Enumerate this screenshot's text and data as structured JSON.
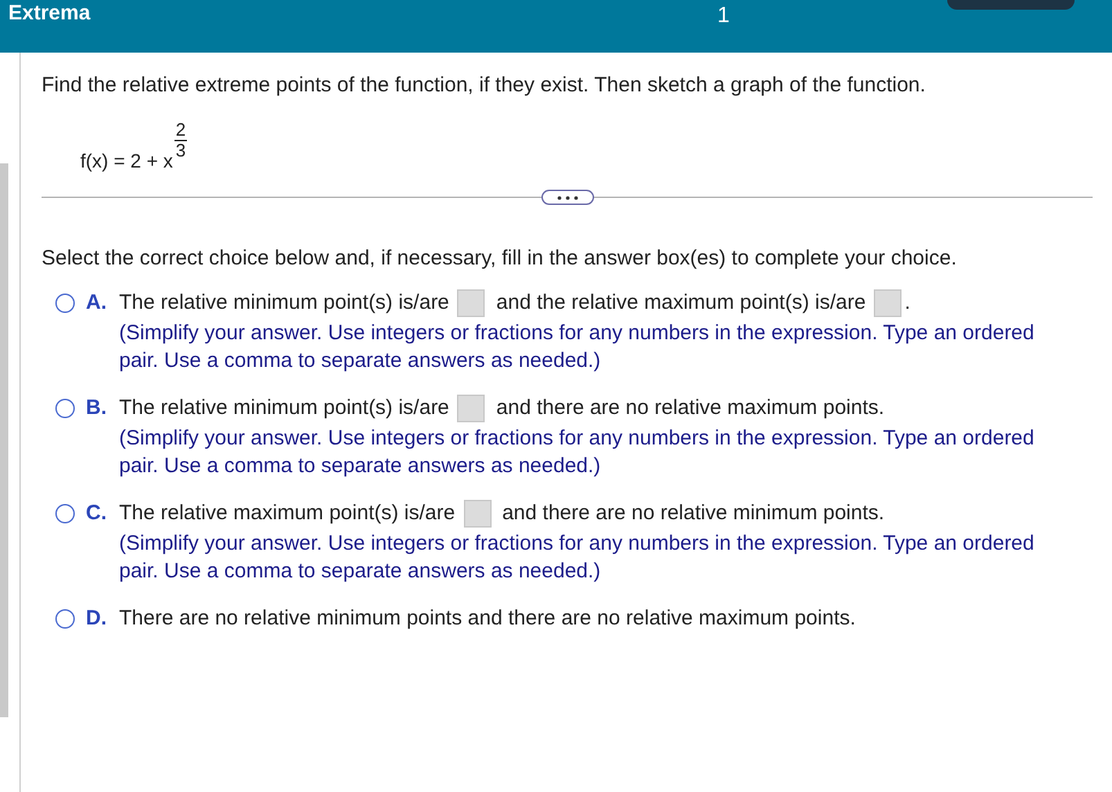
{
  "header": {
    "title": "Extrema",
    "question_number": "1"
  },
  "prompt": "Find the relative extreme points of the function, if they exist. Then sketch a graph of the function.",
  "formula": {
    "base": "f(x) = 2 + x",
    "exponent_numerator": "2",
    "exponent_denominator": "3"
  },
  "instruction": "Select the correct choice below and, if necessary, fill in the answer box(es) to complete your choice.",
  "choices": [
    {
      "letter": "A.",
      "selected": false,
      "segments": [
        {
          "kind": "text",
          "text": "The relative minimum point(s) is/are"
        },
        {
          "kind": "box"
        },
        {
          "kind": "text",
          "text": "and the relative maximum point(s) is/are"
        },
        {
          "kind": "box"
        },
        {
          "kind": "text",
          "text": "."
        }
      ],
      "hint": "(Simplify your answer. Use integers or fractions for any numbers in the expression. Type an ordered pair. Use a comma to separate answers as needed.)"
    },
    {
      "letter": "B.",
      "selected": false,
      "segments": [
        {
          "kind": "text",
          "text": "The relative minimum point(s) is/are"
        },
        {
          "kind": "box"
        },
        {
          "kind": "text",
          "text": "and there are no relative maximum points."
        }
      ],
      "hint": "(Simplify your answer. Use integers or fractions for any numbers in the expression. Type an ordered pair. Use a comma to separate answers as needed.)"
    },
    {
      "letter": "C.",
      "selected": false,
      "segments": [
        {
          "kind": "text",
          "text": "The relative maximum point(s) is/are"
        },
        {
          "kind": "box"
        },
        {
          "kind": "text",
          "text": "and there are no relative minimum points."
        }
      ],
      "hint": "(Simplify your answer. Use integers or fractions for any numbers in the expression. Type an ordered pair. Use a comma to separate answers as needed.)"
    },
    {
      "letter": "D.",
      "selected": false,
      "segments": [
        {
          "kind": "text",
          "text": "There are no relative minimum points and there are no relative maximum points."
        }
      ]
    }
  ]
}
